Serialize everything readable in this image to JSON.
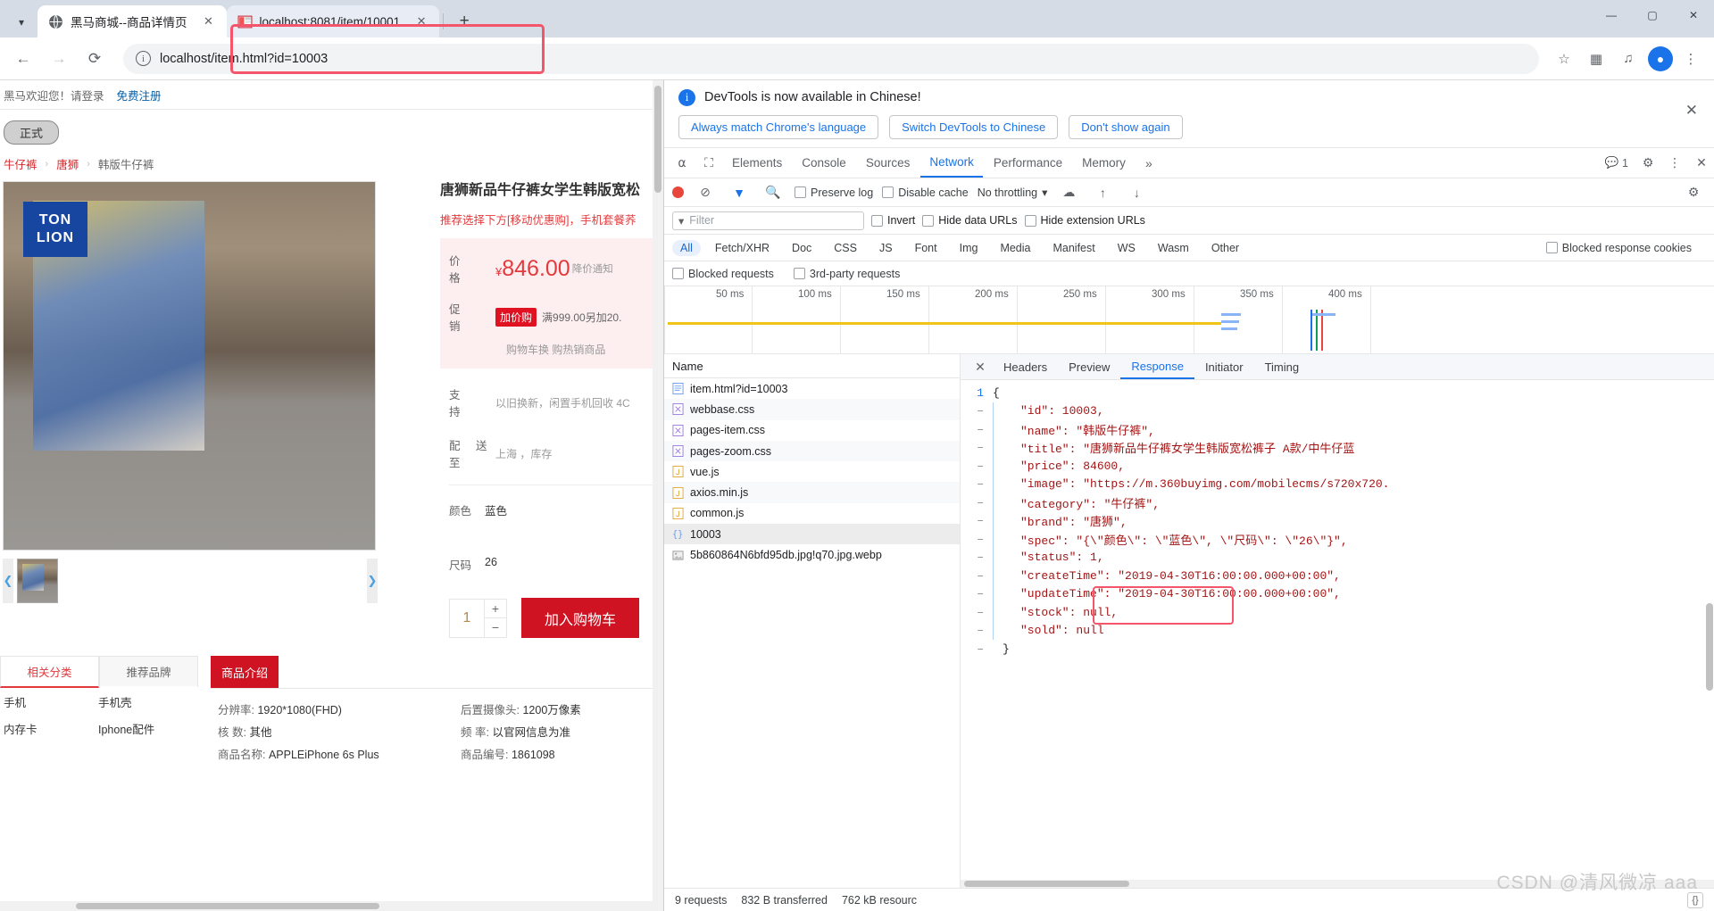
{
  "browser": {
    "tabs": [
      {
        "title": "黑马商城--商品详情页",
        "favicon": "globe-icon",
        "active": true
      },
      {
        "title": "localhost:8081/item/10001",
        "favicon": "site-icon",
        "active": false
      }
    ],
    "new_tab_label": "+",
    "url": "localhost/item.html?id=10003",
    "window_controls": {
      "minimize": "—",
      "maximize": "▢",
      "close": "✕"
    },
    "toolbar_icons": [
      "back-icon",
      "forward-icon",
      "reload-icon",
      "bookmark-star-icon",
      "extensions-icon",
      "media-icon",
      "profile-icon",
      "menu-icon"
    ]
  },
  "shop": {
    "welcome": "黑马欢迎您！请登录",
    "register_link": "免费注册",
    "env_badge": "正式",
    "breadcrumb": [
      "牛仔裤",
      "唐狮",
      "韩版牛仔裤"
    ],
    "product": {
      "title": "唐狮新品牛仔裤女学生韩版宽松",
      "subtitle": "推荐选择下方[移动优惠购]，手机套餐荞",
      "price_label": "价　格",
      "price_currency": "¥",
      "price_value": "846.00",
      "price_note": "降价通知",
      "promo_label": "促　销",
      "promo_tag": "加价购",
      "promo_text": "满999.00另加20.",
      "promo_sub": "购物车换  购热销商品",
      "support_label": "支　持",
      "support_value": "以旧换新，闲置手机回收  4C",
      "ship_label": "配 送 至",
      "ship_value": "上海 ，库存",
      "color_label": "颜色",
      "color_value": "蓝色",
      "size_label": "尺码",
      "size_value": "26",
      "qty_value": "1",
      "qty_plus": "+",
      "qty_minus": "−",
      "cart_button": "加入购物车",
      "logo_line1": "TON",
      "logo_line2": "LION"
    },
    "lower_tabs": [
      {
        "label": "相关分类",
        "selected": true
      },
      {
        "label": "推荐品牌",
        "selected": false
      }
    ],
    "category_rows": [
      [
        "手机",
        "手机壳"
      ],
      [
        "内存卡",
        "Iphone配件"
      ]
    ],
    "desc_tab": "商品介绍",
    "specs_col1": [
      {
        "k": "分辨率:",
        "v": "1920*1080(FHD)"
      },
      {
        "k": "核 数:",
        "v": "其他"
      },
      {
        "k": "商品名称:",
        "v": "APPLEiPhone 6s Plus"
      }
    ],
    "specs_col2": [
      {
        "k": "后置摄像头:",
        "v": "1200万像素"
      },
      {
        "k": "频 率:",
        "v": "以官网信息为准"
      },
      {
        "k": "商品编号:",
        "v": "1861098"
      }
    ]
  },
  "devtools": {
    "banner": {
      "message": "DevTools is now available in Chinese!",
      "buttons": [
        "Always match Chrome's language",
        "Switch DevTools to Chinese",
        "Don't show again"
      ],
      "close": "✕"
    },
    "panels": [
      "Elements",
      "Console",
      "Sources",
      "Network",
      "Performance",
      "Memory"
    ],
    "active_panel": "Network",
    "more_panels": "»",
    "issue_count": "1",
    "toolbar": {
      "preserve_log": "Preserve log",
      "disable_cache": "Disable cache",
      "throttling": "No throttling"
    },
    "filter_placeholder": "Filter",
    "invert": "Invert",
    "hide_data_urls": "Hide data URLs",
    "hide_extension_urls": "Hide extension URLs",
    "types": [
      "All",
      "Fetch/XHR",
      "Doc",
      "CSS",
      "JS",
      "Font",
      "Img",
      "Media",
      "Manifest",
      "WS",
      "Wasm",
      "Other"
    ],
    "active_type": "All",
    "blocked_response_cookies": "Blocked response cookies",
    "blocked_requests": "Blocked requests",
    "third_party_requests": "3rd-party requests",
    "timeline_ticks": [
      "50 ms",
      "100 ms",
      "150 ms",
      "200 ms",
      "250 ms",
      "300 ms",
      "350 ms",
      "400 ms"
    ],
    "name_column_header": "Name",
    "requests": [
      {
        "name": "item.html?id=10003",
        "icon": "doc-icon",
        "selected": false
      },
      {
        "name": "webbase.css",
        "icon": "css-icon",
        "selected": false
      },
      {
        "name": "pages-item.css",
        "icon": "css-icon",
        "selected": false
      },
      {
        "name": "pages-zoom.css",
        "icon": "css-icon",
        "selected": false
      },
      {
        "name": "vue.js",
        "icon": "js-icon",
        "selected": false
      },
      {
        "name": "axios.min.js",
        "icon": "js-icon",
        "selected": false
      },
      {
        "name": "common.js",
        "icon": "js-icon",
        "selected": false
      },
      {
        "name": "10003",
        "icon": "xhr-icon",
        "selected": true
      },
      {
        "name": "5b860864N6bfd95db.jpg!q70.jpg.webp",
        "icon": "img-icon",
        "selected": false
      }
    ],
    "detail_tabs": [
      "Headers",
      "Preview",
      "Response",
      "Initiator",
      "Timing"
    ],
    "active_detail_tab": "Response",
    "response_lines": [
      {
        "gutter": "1",
        "indent": 0,
        "text": "{"
      },
      {
        "gutter": "–",
        "indent": 1,
        "text": "\"id\": 10003,"
      },
      {
        "gutter": "–",
        "indent": 1,
        "text": "\"name\": \"韩版牛仔裤\","
      },
      {
        "gutter": "–",
        "indent": 1,
        "text": "\"title\": \"唐狮新品牛仔裤女学生韩版宽松裤子  A款/中牛仔蓝"
      },
      {
        "gutter": "–",
        "indent": 1,
        "text": "\"price\": 84600,"
      },
      {
        "gutter": "–",
        "indent": 1,
        "text": "\"image\": \"https://m.360buyimg.com/mobilecms/s720x720."
      },
      {
        "gutter": "–",
        "indent": 1,
        "text": "\"category\": \"牛仔裤\","
      },
      {
        "gutter": "–",
        "indent": 1,
        "text": "\"brand\": \"唐狮\","
      },
      {
        "gutter": "–",
        "indent": 1,
        "text": "\"spec\": \"{\\\"颜色\\\": \\\"蓝色\\\", \\\"尺码\\\": \\\"26\\\"}\","
      },
      {
        "gutter": "–",
        "indent": 1,
        "text": "\"status\": 1,"
      },
      {
        "gutter": "–",
        "indent": 1,
        "text": "\"createTime\": \"2019-04-30T16:00:00.000+00:00\","
      },
      {
        "gutter": "–",
        "indent": 1,
        "text": "\"updateTime\": \"2019-04-30T16:00:00.000+00:00\","
      },
      {
        "gutter": "–",
        "indent": 1,
        "text": "\"stock\": null,"
      },
      {
        "gutter": "–",
        "indent": 1,
        "text": "\"sold\": null"
      },
      {
        "gutter": "–",
        "indent": 0,
        "text": "}"
      }
    ],
    "status": {
      "requests": "9 requests",
      "transferred": "832 B transferred",
      "resources": "762 kB resourc"
    },
    "console_icon": "{}"
  },
  "watermark": "CSDN @清风微凉  aaa",
  "colors": {
    "accent_red": "#cf1322",
    "price_red": "#e4393c",
    "devtools_blue": "#1a73e8",
    "highlight_red": "#f4556a"
  }
}
